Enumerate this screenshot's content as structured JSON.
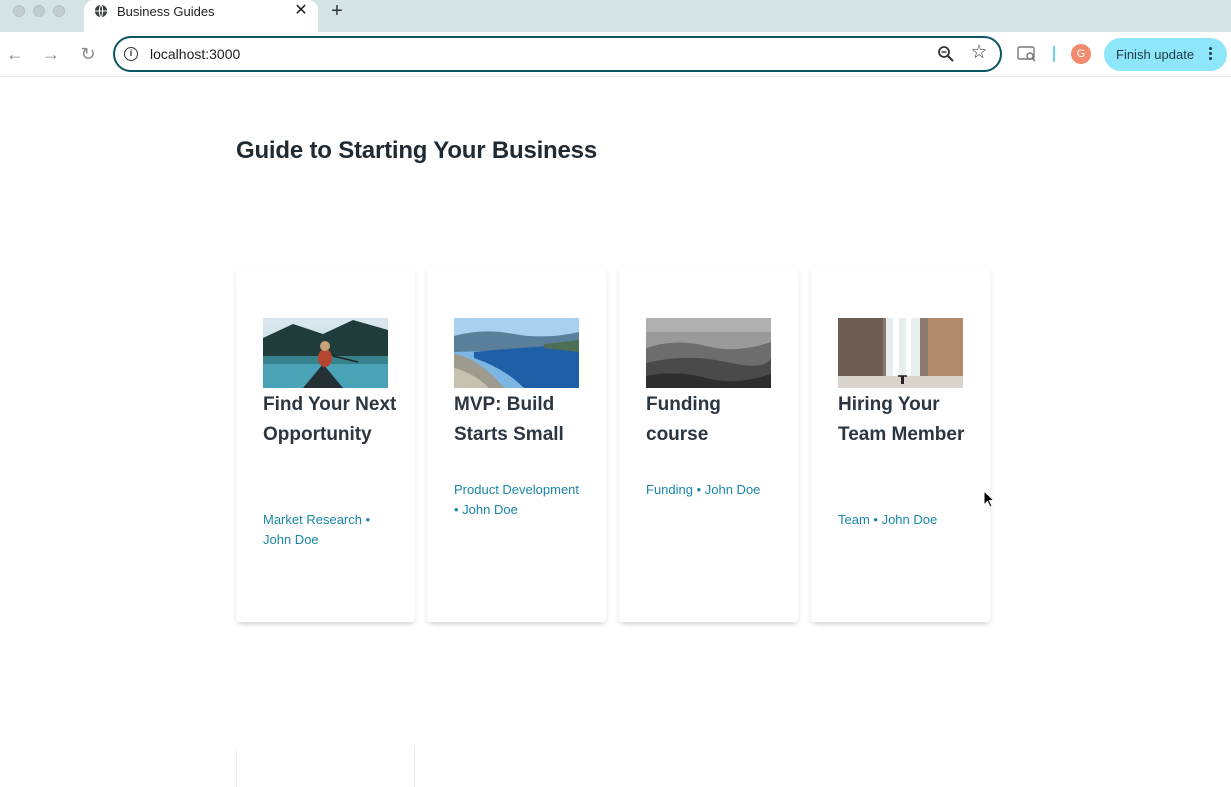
{
  "browser": {
    "tab_title": "Business Guides",
    "tab_close": "✕",
    "new_tab": "+",
    "url": "localhost:3000",
    "avatar_initial": "G",
    "update_label": "Finish update",
    "nav": {
      "back": "←",
      "forward": "→",
      "reload": "↻"
    },
    "star": "☆"
  },
  "page": {
    "title": "Guide to Starting Your Business"
  },
  "cards": [
    {
      "title": "Find Your Next Opportunity",
      "category": "Market Research",
      "author": "John Doe",
      "meta": "Market Research • John Doe"
    },
    {
      "title": "MVP: Build Starts Small",
      "category": "Product Development",
      "author": "John Doe",
      "meta": "Product Development • John Doe"
    },
    {
      "title": "Funding course",
      "category": "Funding",
      "author": "John Doe",
      "meta": "Funding • John Doe"
    },
    {
      "title": "Hiring Your Team Member",
      "category": "Team",
      "author": "John Doe",
      "meta": "Team • John Doe"
    }
  ],
  "colors": {
    "accent": "#1a86a8",
    "title": "#1f2a33",
    "update_button": "#8ee6fb",
    "omnibox_border": "#0b5564"
  },
  "icons": [
    "globe-icon",
    "close-icon",
    "plus-icon",
    "back-arrow-icon",
    "forward-arrow-icon",
    "reload-icon",
    "info-icon",
    "zoom-icon",
    "star-icon",
    "extension-icon",
    "kebab-menu-icon",
    "cursor-icon"
  ]
}
